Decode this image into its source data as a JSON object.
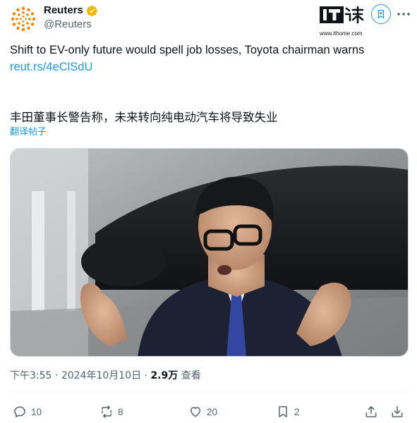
{
  "author": {
    "display_name": "Reuters",
    "handle": "@Reuters",
    "avatar_icon": "reuters-logo-icon",
    "verified_icon": "verified-badge-icon",
    "verified_color": "#F7B500"
  },
  "watermark": {
    "logo_text": "IT之家",
    "url": "www.ithome.com"
  },
  "tweet": {
    "text": "Shift to EV-only future would spell job losses, Toyota chairman warns",
    "link": "reut.rs/4eClSdU"
  },
  "translation": {
    "text": "丰田董事长警告称，未来转向纯电动汽车将导致失业",
    "link_label": "翻译帖子"
  },
  "media": {
    "description_icon": "photo-image"
  },
  "meta": {
    "time": "下午3:55",
    "separator": "·",
    "date": "2024年10月10日",
    "views_count": "2.9万",
    "views_label": "查看"
  },
  "actions": {
    "replies": "10",
    "reposts": "8",
    "likes": "20",
    "bookmarks": "2"
  },
  "colors": {
    "accent": "#1d9bf0",
    "text": "#0f1419",
    "secondary": "#536471",
    "reuters_orange": "#FF8000"
  }
}
